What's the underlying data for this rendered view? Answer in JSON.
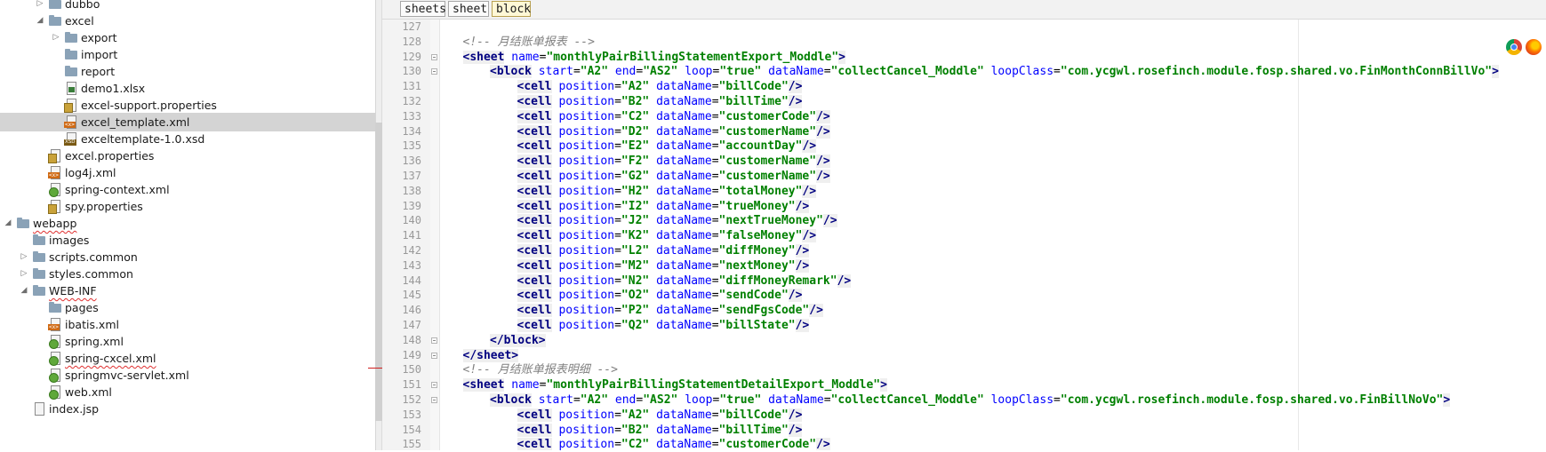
{
  "project_tree": [
    {
      "label": "dubbo",
      "icon": "folder-icon",
      "indent": 5,
      "arrow": "collapsed"
    },
    {
      "label": "excel",
      "icon": "folder-icon",
      "indent": 5,
      "arrow": "expanded"
    },
    {
      "label": "export",
      "icon": "folder-icon",
      "indent": 6,
      "arrow": "collapsed"
    },
    {
      "label": "import",
      "icon": "folder-icon",
      "indent": 6,
      "arrow": "none"
    },
    {
      "label": "report",
      "icon": "folder-icon",
      "indent": 6,
      "arrow": "none"
    },
    {
      "label": "demo1.xlsx",
      "icon": "xlsx-file-icon",
      "indent": 6,
      "arrow": "none"
    },
    {
      "label": "excel-support.properties",
      "icon": "properties-file-icon",
      "indent": 6,
      "arrow": "none"
    },
    {
      "label": "excel_template.xml",
      "icon": "xml-file-icon",
      "indent": 6,
      "arrow": "none",
      "selected": true
    },
    {
      "label": "exceltemplate-1.0.xsd",
      "icon": "xsd-file-icon",
      "indent": 6,
      "arrow": "none"
    },
    {
      "label": "excel.properties",
      "icon": "properties-file-icon",
      "indent": 5,
      "arrow": "none"
    },
    {
      "label": "log4j.xml",
      "icon": "xml-file-icon",
      "indent": 5,
      "arrow": "none"
    },
    {
      "label": "spring-context.xml",
      "icon": "spring-xml-icon",
      "indent": 5,
      "arrow": "none"
    },
    {
      "label": "spy.properties",
      "icon": "properties-file-icon",
      "indent": 5,
      "arrow": "none"
    },
    {
      "label": "webapp",
      "icon": "folder-icon",
      "indent": 3,
      "arrow": "expanded",
      "squiggle": true
    },
    {
      "label": "images",
      "icon": "folder-icon",
      "indent": 4,
      "arrow": "none"
    },
    {
      "label": "scripts.common",
      "icon": "folder-icon",
      "indent": 4,
      "arrow": "collapsed"
    },
    {
      "label": "styles.common",
      "icon": "folder-icon",
      "indent": 4,
      "arrow": "collapsed"
    },
    {
      "label": "WEB-INF",
      "icon": "folder-icon",
      "indent": 4,
      "arrow": "expanded",
      "squiggle": true
    },
    {
      "label": "pages",
      "icon": "folder-icon",
      "indent": 5,
      "arrow": "none"
    },
    {
      "label": "ibatis.xml",
      "icon": "xml-file-icon",
      "indent": 5,
      "arrow": "none"
    },
    {
      "label": "spring.xml",
      "icon": "spring-xml-icon",
      "indent": 5,
      "arrow": "none"
    },
    {
      "label": "spring-cxcel.xml",
      "icon": "spring-xml-icon",
      "indent": 5,
      "arrow": "none",
      "squiggle": true
    },
    {
      "label": "springmvc-servlet.xml",
      "icon": "spring-xml-icon",
      "indent": 5,
      "arrow": "none"
    },
    {
      "label": "web.xml",
      "icon": "spring-xml-icon",
      "indent": 5,
      "arrow": "none"
    },
    {
      "label": "index.jsp",
      "icon": "file-icon",
      "indent": 4,
      "arrow": "none"
    }
  ],
  "breadcrumb": [
    {
      "label": "sheets",
      "active": false
    },
    {
      "label": "sheet",
      "active": false
    },
    {
      "label": "block",
      "active": true
    }
  ],
  "editor": {
    "lines": [
      {
        "n": "127",
        "ind": 0,
        "fold": false,
        "t": []
      },
      {
        "n": "128",
        "ind": 1,
        "fold": false,
        "t": [
          [
            "cm",
            "<!-- 月结账单报表 -->"
          ]
        ]
      },
      {
        "n": "129",
        "ind": 1,
        "fold": true,
        "t": [
          [
            "tg",
            "<sheet"
          ],
          [
            "p",
            " "
          ],
          [
            "an",
            "name"
          ],
          [
            "p",
            "="
          ],
          [
            "av",
            "\"monthlyPairBillingStatementExport_Moddle\""
          ],
          [
            "tg",
            ">"
          ]
        ]
      },
      {
        "n": "130",
        "ind": 2,
        "fold": true,
        "t": [
          [
            "tg",
            "<block"
          ],
          [
            "p",
            " "
          ],
          [
            "an",
            "start"
          ],
          [
            "p",
            "="
          ],
          [
            "av",
            "\"A2\""
          ],
          [
            "p",
            " "
          ],
          [
            "an",
            "end"
          ],
          [
            "p",
            "="
          ],
          [
            "av",
            "\"AS2\""
          ],
          [
            "p",
            " "
          ],
          [
            "an",
            "loop"
          ],
          [
            "p",
            "="
          ],
          [
            "av",
            "\"true\""
          ],
          [
            "p",
            " "
          ],
          [
            "an",
            "dataName"
          ],
          [
            "p",
            "="
          ],
          [
            "av",
            "\"collectCancel_Moddle\""
          ],
          [
            "p",
            " "
          ],
          [
            "an",
            "loopClass"
          ],
          [
            "p",
            "="
          ],
          [
            "av",
            "\"com.ycgwl.rosefinch.module.fosp.shared.vo.FinMonthConnBillVo\""
          ],
          [
            "tg",
            ">"
          ]
        ]
      },
      {
        "n": "131",
        "ind": 3,
        "fold": false,
        "cell": [
          "A2",
          "billCode"
        ]
      },
      {
        "n": "132",
        "ind": 3,
        "fold": false,
        "cell": [
          "B2",
          "billTime"
        ]
      },
      {
        "n": "133",
        "ind": 3,
        "fold": false,
        "cell": [
          "C2",
          "customerCode"
        ]
      },
      {
        "n": "134",
        "ind": 3,
        "fold": false,
        "cell": [
          "D2",
          "customerName"
        ]
      },
      {
        "n": "135",
        "ind": 3,
        "fold": false,
        "cell": [
          "E2",
          "accountDay"
        ]
      },
      {
        "n": "136",
        "ind": 3,
        "fold": false,
        "cell": [
          "F2",
          "customerName"
        ]
      },
      {
        "n": "137",
        "ind": 3,
        "fold": false,
        "cell": [
          "G2",
          "customerName"
        ]
      },
      {
        "n": "138",
        "ind": 3,
        "fold": false,
        "cell": [
          "H2",
          "totalMoney"
        ]
      },
      {
        "n": "139",
        "ind": 3,
        "fold": false,
        "cell": [
          "I2",
          "trueMoney"
        ]
      },
      {
        "n": "140",
        "ind": 3,
        "fold": false,
        "cell": [
          "J2",
          "nextTrueMoney"
        ]
      },
      {
        "n": "141",
        "ind": 3,
        "fold": false,
        "cell": [
          "K2",
          "falseMoney"
        ]
      },
      {
        "n": "142",
        "ind": 3,
        "fold": false,
        "cell": [
          "L2",
          "diffMoney"
        ]
      },
      {
        "n": "143",
        "ind": 3,
        "fold": false,
        "cell": [
          "M2",
          "nextMoney"
        ]
      },
      {
        "n": "144",
        "ind": 3,
        "fold": false,
        "cell": [
          "N2",
          "diffMoneyRemark"
        ]
      },
      {
        "n": "145",
        "ind": 3,
        "fold": false,
        "cell": [
          "O2",
          "sendCode"
        ]
      },
      {
        "n": "146",
        "ind": 3,
        "fold": false,
        "cell": [
          "P2",
          "sendFgsCode"
        ]
      },
      {
        "n": "147",
        "ind": 3,
        "fold": false,
        "cell": [
          "Q2",
          "billState"
        ]
      },
      {
        "n": "148",
        "ind": 2,
        "fold": true,
        "t": [
          [
            "tg",
            "</block>"
          ]
        ]
      },
      {
        "n": "149",
        "ind": 1,
        "fold": true,
        "t": [
          [
            "tg",
            "</sheet>"
          ]
        ]
      },
      {
        "n": "150",
        "ind": 1,
        "fold": false,
        "t": [
          [
            "cm",
            "<!-- 月结账单报表明细 -->"
          ]
        ]
      },
      {
        "n": "151",
        "ind": 1,
        "fold": true,
        "t": [
          [
            "tg",
            "<sheet"
          ],
          [
            "p",
            " "
          ],
          [
            "an",
            "name"
          ],
          [
            "p",
            "="
          ],
          [
            "av",
            "\"monthlyPairBillingStatementDetailExport_Moddle\""
          ],
          [
            "tg",
            ">"
          ]
        ]
      },
      {
        "n": "152",
        "ind": 2,
        "fold": true,
        "t": [
          [
            "tg",
            "<block"
          ],
          [
            "p",
            " "
          ],
          [
            "an",
            "start"
          ],
          [
            "p",
            "="
          ],
          [
            "av",
            "\"A2\""
          ],
          [
            "p",
            " "
          ],
          [
            "an",
            "end"
          ],
          [
            "p",
            "="
          ],
          [
            "av",
            "\"AS2\""
          ],
          [
            "p",
            " "
          ],
          [
            "an",
            "loop"
          ],
          [
            "p",
            "="
          ],
          [
            "av",
            "\"true\""
          ],
          [
            "p",
            " "
          ],
          [
            "an",
            "dataName"
          ],
          [
            "p",
            "="
          ],
          [
            "av",
            "\"collectCancel_Moddle\""
          ],
          [
            "p",
            " "
          ],
          [
            "an",
            "loopClass"
          ],
          [
            "p",
            "="
          ],
          [
            "av",
            "\"com.ycgwl.rosefinch.module.fosp.shared.vo.FinBillNoVo\""
          ],
          [
            "tg",
            ">"
          ]
        ]
      },
      {
        "n": "153",
        "ind": 3,
        "fold": false,
        "cell": [
          "A2",
          "billCode"
        ]
      },
      {
        "n": "154",
        "ind": 3,
        "fold": false,
        "cell": [
          "B2",
          "billTime"
        ]
      },
      {
        "n": "155",
        "ind": 3,
        "fold": false,
        "cell": [
          "C2",
          "customerCode"
        ]
      }
    ]
  },
  "browser_icons": [
    {
      "name": "chrome-icon",
      "label": "Chrome"
    },
    {
      "name": "firefox-icon",
      "label": "Firefox"
    }
  ],
  "colors": {
    "tag": "#000080",
    "attr_name": "#0000ff",
    "attr_value": "#008000",
    "comment": "#808080",
    "selection": "#d4d4d4",
    "crumb_active": "#fff8d6"
  }
}
